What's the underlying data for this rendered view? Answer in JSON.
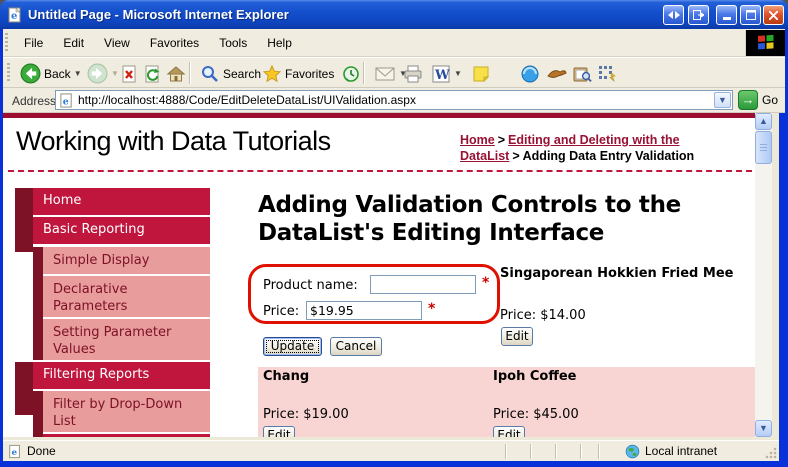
{
  "window": {
    "title": "Untitled Page - Microsoft Internet Explorer"
  },
  "menu_bar": {
    "items": [
      "File",
      "Edit",
      "View",
      "Favorites",
      "Tools",
      "Help"
    ]
  },
  "toolbar": {
    "back_label": "Back",
    "search_label": "Search",
    "favorites_label": "Favorites"
  },
  "address_bar": {
    "label": "Address",
    "url": "http://localhost:4888/Code/EditDeleteDataList/UIValidation.aspx",
    "go_label": "Go"
  },
  "page": {
    "site_title": "Working with Data Tutorials",
    "breadcrumb": {
      "home_link": "Home",
      "separator": ">",
      "section_link": "Editing and Deleting with the DataList",
      "current": "Adding Data Entry Validation"
    },
    "sidebar": {
      "items": [
        {
          "label": "Home",
          "level": 0
        },
        {
          "label": "Basic Reporting",
          "level": 0
        },
        {
          "label": "Simple Display",
          "level": 1
        },
        {
          "label": "Declarative Parameters",
          "level": 1
        },
        {
          "label": "Setting Parameter Values",
          "level": 1
        },
        {
          "label": "Filtering Reports",
          "level": 0
        },
        {
          "label": "Filter by Drop-Down List",
          "level": 1
        }
      ]
    },
    "content": {
      "heading": "Adding Validation Controls to the DataList's Editing Interface",
      "edit_form": {
        "product_name_label": "Product name:",
        "product_name_value": "",
        "price_label": "Price:",
        "price_value": "$19.95",
        "required_marker": "*",
        "update_label": "Update",
        "cancel_label": "Cancel"
      },
      "edit_button_label": "Edit",
      "products": [
        {
          "name": "Singaporean Hokkien Fried Mee",
          "price_line": "Price: $14.00"
        },
        {
          "name": "Chang",
          "price_line": "Price: $19.00"
        },
        {
          "name": "Ipoh Coffee",
          "price_line": "Price: $45.00"
        }
      ]
    }
  },
  "status_bar": {
    "status": "Done",
    "zone": "Local intranet"
  },
  "colors": {
    "accent_crimson": "#c0163e",
    "dark_maroon": "#7d1126",
    "sidebar_pink": "#e89c9c",
    "row_pink": "#f8d5d3",
    "annotation_red": "#e01000",
    "link_maroon": "#991133",
    "titlebar_blue": "#1550cc"
  }
}
